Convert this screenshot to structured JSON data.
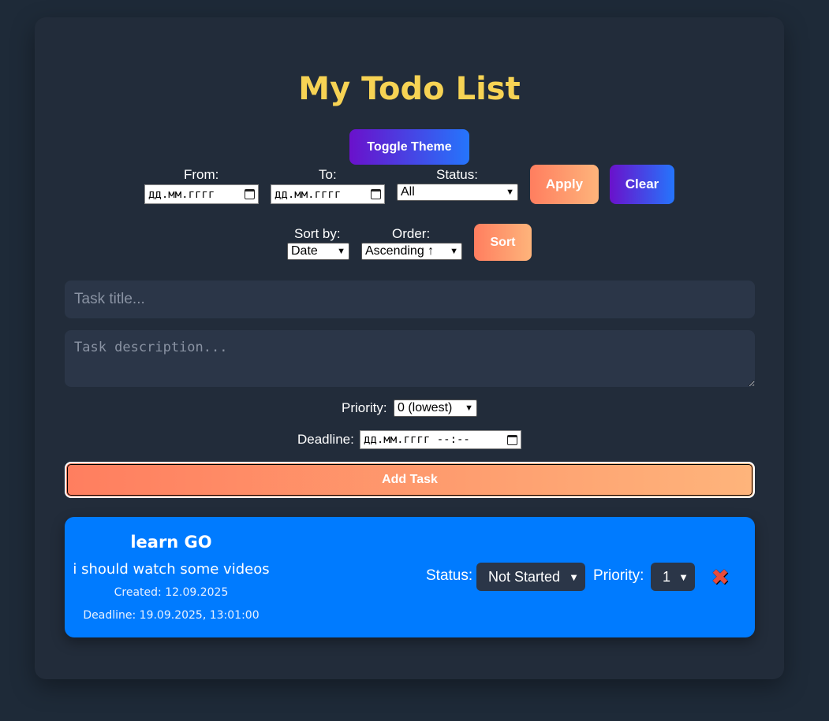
{
  "app": {
    "title": "My Todo List"
  },
  "toolbar": {
    "toggle_theme": "Toggle Theme"
  },
  "filters": {
    "from_label": "From:",
    "from_value": "дд.мм.гггг",
    "to_label": "To:",
    "to_value": "дд.мм.гггг",
    "status_label": "Status:",
    "status_value": "All",
    "apply": "Apply",
    "clear": "Clear"
  },
  "sorting": {
    "sort_by_label": "Sort by:",
    "sort_by_value": "Date",
    "order_label": "Order:",
    "order_value": "Ascending ↑",
    "sort": "Sort"
  },
  "form": {
    "title_placeholder": "Task title...",
    "description_placeholder": "Task description...",
    "priority_label": "Priority:",
    "priority_value": "0 (lowest)",
    "deadline_label": "Deadline:",
    "deadline_value": "дд.мм.гггг --:--",
    "add_task": "Add Task"
  },
  "tasks": [
    {
      "title": "learn GO",
      "description": "i should watch some videos",
      "created": "Created: 12.09.2025",
      "deadline": "Deadline: 19.09.2025, 13:01:00",
      "status_label": "Status:",
      "status_value": "Not Started",
      "priority_label": "Priority:",
      "priority_value": "1",
      "delete_icon": "close-icon"
    }
  ],
  "colors": {
    "background": "#1e2a38",
    "card": "#222c3a",
    "title": "#f7d354",
    "task_card": "#007bff",
    "purple_gradient": [
      "#6a11cb",
      "#2575fc"
    ],
    "orange_gradient": [
      "#ff7e5f",
      "#feb47b"
    ]
  }
}
